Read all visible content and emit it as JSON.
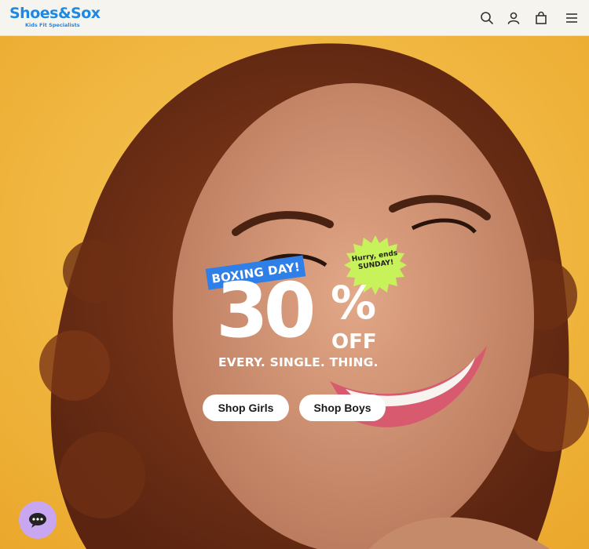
{
  "header": {
    "logo_text": "Shoes&Sox",
    "logo_tagline": "Kids Fit Specialists",
    "icons": [
      "search-icon",
      "account-icon",
      "bag-icon",
      "menu-icon"
    ]
  },
  "promo": {
    "ribbon": "BOXING DAY!",
    "badge_line1": "Hurry, ends",
    "badge_line2": "SUNDAY!",
    "discount_number": "30",
    "discount_symbol": "%",
    "discount_suffix": "OFF",
    "tagline": "EVERY. SINGLE. THING."
  },
  "buttons": {
    "shop_girls": "Shop Girls",
    "shop_boys": "Shop Boys"
  },
  "chat": {
    "icon": "chat-icon"
  },
  "colors": {
    "brand_blue": "#1e88e5",
    "ribbon_blue": "#2f7fe8",
    "badge_green": "#c8f25a",
    "hero_yellow": "#f2b83a",
    "chat_purple": "#c8a7f0"
  }
}
